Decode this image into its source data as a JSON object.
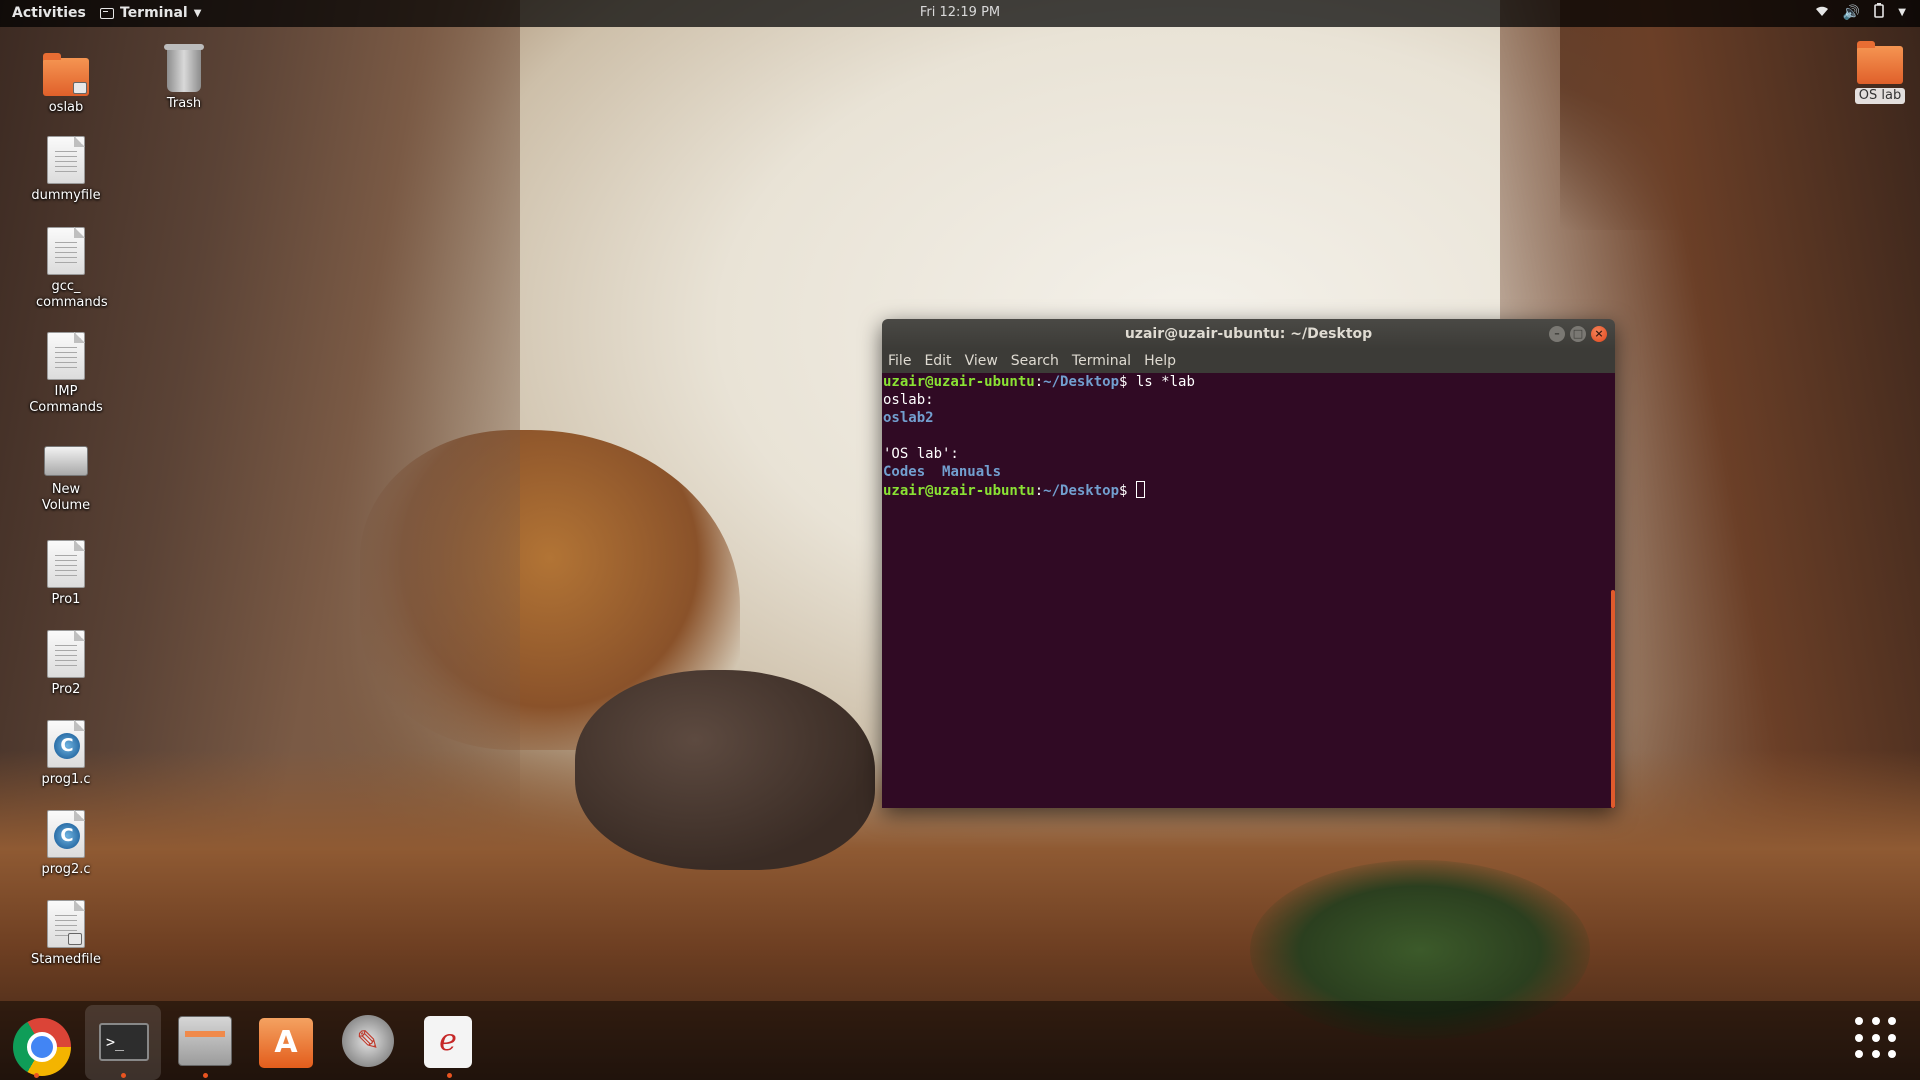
{
  "topbar": {
    "activities": "Activities",
    "app_menu": "Terminal",
    "clock": "Fri 12:19 PM"
  },
  "desktop": {
    "left_icons": [
      {
        "label": "oslab",
        "type": "folder-locked"
      },
      {
        "label": "dummyfile",
        "type": "document"
      },
      {
        "label": "gcc_ commands",
        "type": "document"
      },
      {
        "label": "IMP Commands",
        "type": "document"
      },
      {
        "label": "New Volume",
        "type": "drive"
      },
      {
        "label": "Pro1",
        "type": "document"
      },
      {
        "label": "Pro2",
        "type": "document"
      },
      {
        "label": "prog1.c",
        "type": "c-source"
      },
      {
        "label": "prog2.c",
        "type": "c-source"
      },
      {
        "label": "Stamedfile",
        "type": "document-locked"
      }
    ],
    "trash_label": "Trash",
    "right_folder_label": "OS lab"
  },
  "terminal": {
    "title": "uzair@uzair-ubuntu: ~/Desktop",
    "menu": [
      "File",
      "Edit",
      "View",
      "Search",
      "Terminal",
      "Help"
    ],
    "prompt_user": "uzair@uzair-ubuntu",
    "prompt_sep": ":",
    "prompt_path": "~/Desktop",
    "prompt_end": "$ ",
    "command": "ls *lab",
    "out_heading1": "oslab:",
    "out_dir1": "oslab2",
    "out_heading2": "'OS lab':",
    "out_dir2a": "Codes",
    "out_dir2b": "Manuals"
  },
  "dock": {
    "items": [
      "chrome-icon",
      "terminal-icon",
      "files-icon",
      "software-center-icon",
      "settings-icon",
      "document-viewer-icon",
      "show-apps-icon"
    ]
  },
  "colors": {
    "terminal_bg": "#300a24",
    "prompt_user": "#8ae234",
    "prompt_path": "#729fcf",
    "accent": "#e95420"
  }
}
